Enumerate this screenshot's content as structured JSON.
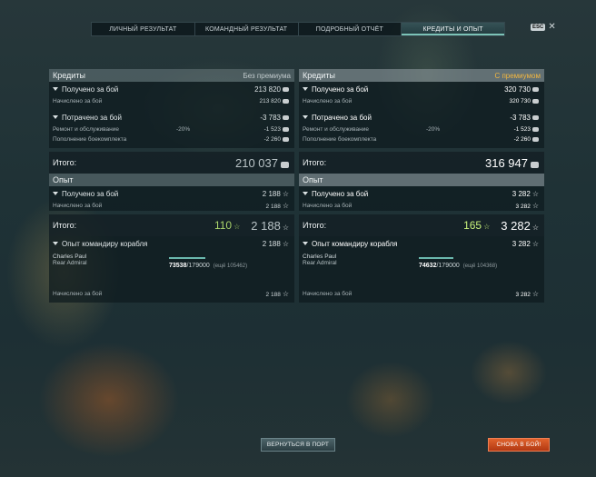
{
  "tabs": [
    {
      "label": "ЛИЧНЫЙ РЕЗУЛЬТАТ"
    },
    {
      "label": "КОМАНДНЫЙ РЕЗУЛЬТАТ"
    },
    {
      "label": "ПОДРОБНЫЙ ОТЧЁТ"
    },
    {
      "label": "КРЕДИТЫ И ОПЫТ"
    }
  ],
  "esc": {
    "key": "ESC",
    "close": "✕"
  },
  "left": {
    "credits_title": "Кредиты",
    "credits_sub": "Без премиума",
    "earned_label": "Получено за бой",
    "earned_value": "213 820",
    "accrued_label": "Начислено за бой",
    "accrued_value": "213 820",
    "spent_label": "Потрачено за бой",
    "spent_value": "-3 783",
    "repair_label": "Ремонт и обслуживание",
    "repair_pct": "-20%",
    "repair_value": "-1 523",
    "ammo_label": "Пополнение боекомплекта",
    "ammo_value": "-2 260",
    "total_label": "Итого:",
    "total_value": "210 037",
    "xp_title": "Опыт",
    "xp_earned_label": "Получено за бой",
    "xp_earned_value": "2 188",
    "xp_accrued_label": "Начислено за бой",
    "xp_accrued_value": "2 188",
    "xp_total_label": "Итого:",
    "xp_total_free": "110",
    "xp_total_value": "2 188",
    "cmd_label": "Опыт командиру корабля",
    "cmd_value": "2 188",
    "cmd_name": "Charles Paul",
    "cmd_rank": "Rear Admiral",
    "cmd_points": "73538",
    "cmd_points_max": "/179000",
    "cmd_more": "(ещё 105462)",
    "cmd_accrued_label": "Начислено за бой",
    "cmd_accrued_value": "2 188"
  },
  "right": {
    "credits_title": "Кредиты",
    "credits_sub": "С премиумом",
    "earned_label": "Получено за бой",
    "earned_value": "320 730",
    "accrued_label": "Начислено за бой",
    "accrued_value": "320 730",
    "spent_label": "Потрачено за бой",
    "spent_value": "-3 783",
    "repair_label": "Ремонт и обслуживание",
    "repair_pct": "-20%",
    "repair_value": "-1 523",
    "ammo_label": "Пополнение боекомплекта",
    "ammo_value": "-2 260",
    "total_label": "Итого:",
    "total_value": "316 947",
    "xp_title": "Опыт",
    "xp_earned_label": "Получено за бой",
    "xp_earned_value": "3 282",
    "xp_accrued_label": "Начислено за бой",
    "xp_accrued_value": "3 282",
    "xp_total_label": "Итого:",
    "xp_total_free": "165",
    "xp_total_value": "3 282",
    "cmd_label": "Опыт командиру корабля",
    "cmd_value": "3 282",
    "cmd_name": "Charles Paul",
    "cmd_rank": "Rear Admiral",
    "cmd_points": "74632",
    "cmd_points_max": "/179000",
    "cmd_more": "(ещё 104368)",
    "cmd_accrued_label": "Начислено за бой",
    "cmd_accrued_value": "3 282"
  },
  "buttons": {
    "port": "ВЕРНУТЬСЯ В ПОРТ",
    "battle": "СНОВА В БОЙ!"
  },
  "colors": {
    "accent": "#f2b640",
    "battle": "#d24b1f",
    "xp_free": "#a9d36a"
  }
}
